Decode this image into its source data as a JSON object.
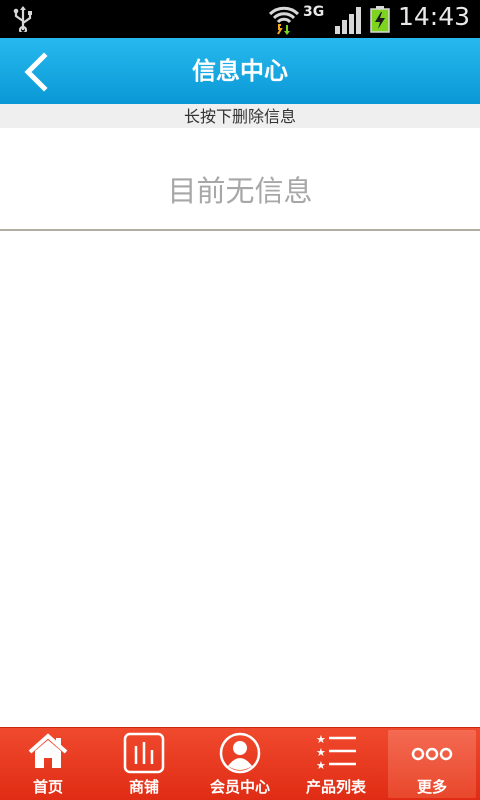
{
  "status_bar": {
    "network_type": "3G",
    "time": "14:43",
    "icons": [
      "usb-icon",
      "wifi-icon",
      "signal-icon",
      "battery-charging-icon"
    ]
  },
  "header": {
    "title": "信息中心",
    "back_icon": "chevron-left-icon"
  },
  "hint": "长按下删除信息",
  "empty_message": "目前无信息",
  "colors": {
    "header_top": "#27b9ee",
    "header_bottom": "#0a98d6",
    "nav_bg": "#e8391f",
    "empty_text": "#a7a7a7"
  },
  "bottom_nav": {
    "items": [
      {
        "label": "首页",
        "icon": "home-icon"
      },
      {
        "label": "商铺",
        "icon": "store-icon"
      },
      {
        "label": "会员中心",
        "icon": "user-icon"
      },
      {
        "label": "产品列表",
        "icon": "list-icon"
      },
      {
        "label": "更多",
        "icon": "more-icon"
      }
    ],
    "active_label": "更多"
  }
}
